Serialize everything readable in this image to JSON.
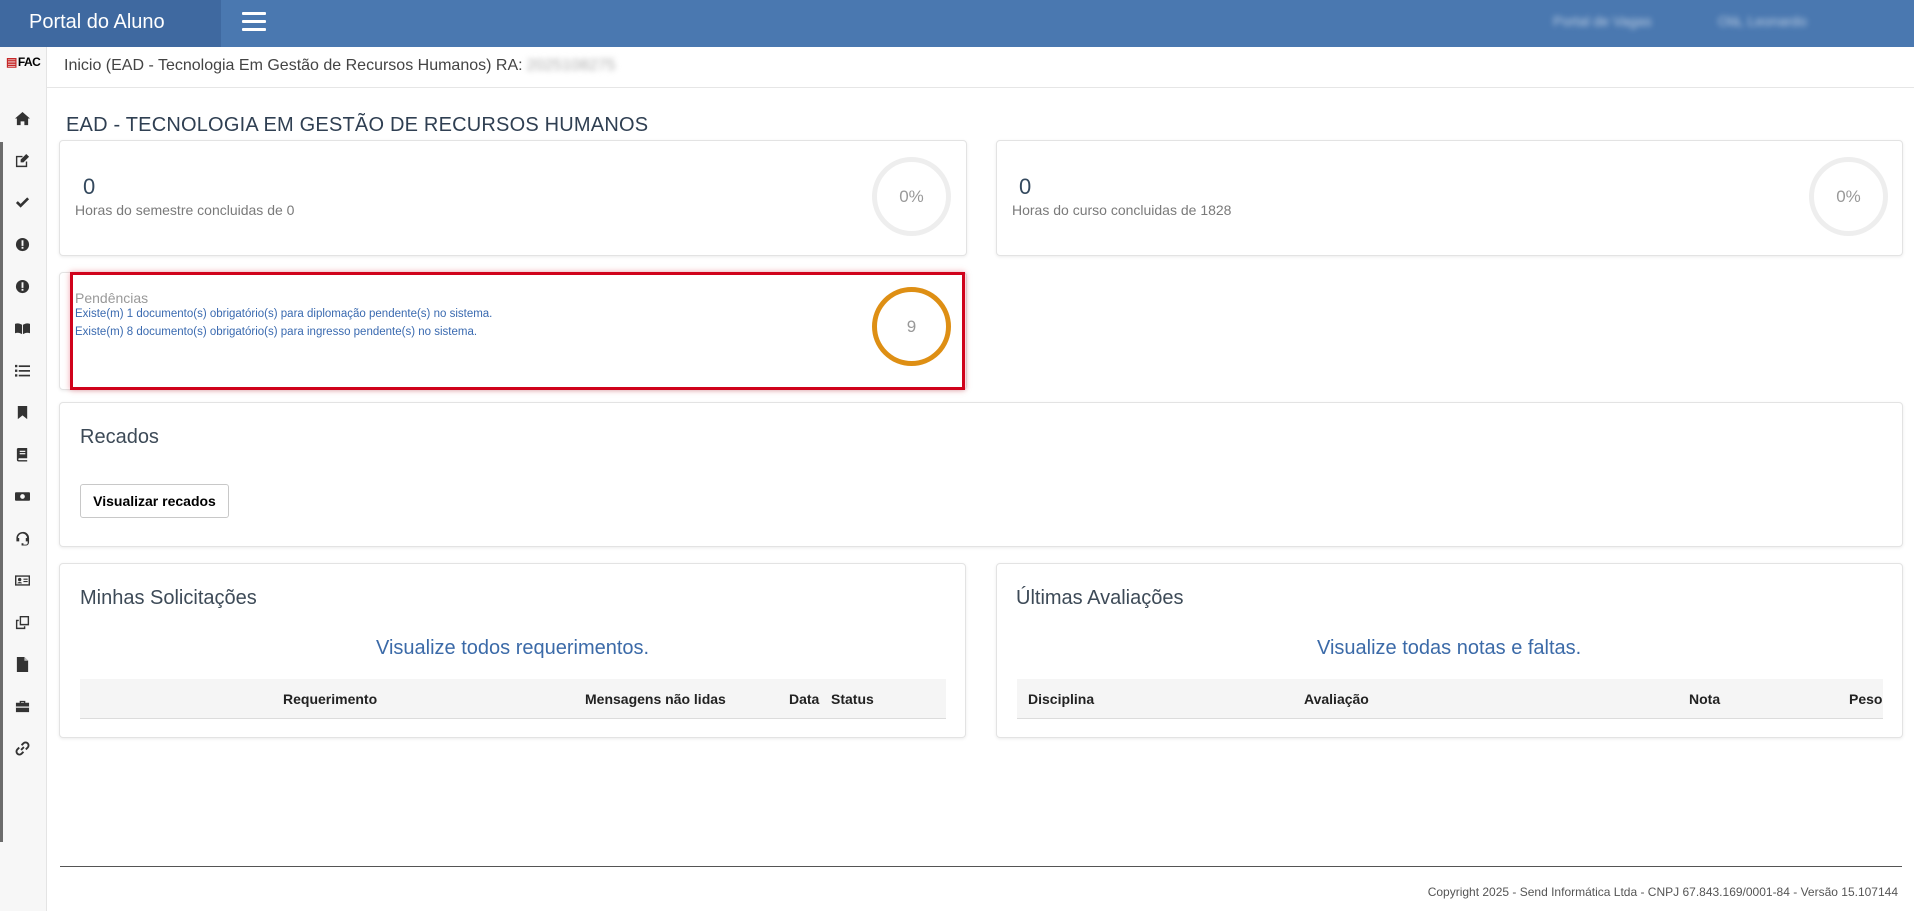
{
  "header": {
    "brand": "Portal do Aluno",
    "portal_vagas": "Portal de Vagas",
    "user": "Olá, Leonardo"
  },
  "sidebar": {
    "logo": "FAC",
    "icons": [
      "home-icon",
      "edit-icon",
      "check-icon",
      "alert-icon",
      "alert-icon-2",
      "book-open-icon",
      "list-icon",
      "bookmark-icon",
      "book-icon",
      "money-icon",
      "headset-icon",
      "id-card-icon",
      "clone-icon",
      "file-icon",
      "briefcase-icon",
      "link-icon"
    ]
  },
  "breadcrumb": {
    "text": "Inicio (EAD - Tecnologia Em Gestão de Recursos Humanos) RA:",
    "ra": "2025108275"
  },
  "page_title": "EAD - TECNOLOGIA EM GESTÃO DE RECURSOS HUMANOS",
  "semester": {
    "value": "0",
    "label": "Horas do semestre concluidas de 0",
    "percent": "0%"
  },
  "course": {
    "value": "0",
    "label": "Horas do curso concluidas de 1828",
    "percent": "0%"
  },
  "pendencias": {
    "title": "Pendências",
    "items": [
      "Existe(m) 1 documento(s) obrigatório(s) para diplomação pendente(s) no sistema.",
      "Existe(m) 8 documento(s) obrigatório(s) para ingresso pendente(s) no sistema."
    ],
    "count": "9",
    "ring_color": "#de8f14"
  },
  "recados": {
    "title": "Recados",
    "button": "Visualizar recados"
  },
  "solicitacoes": {
    "title": "Minhas Solicitações",
    "view_all": "Visualize todos requerimentos.",
    "columns": [
      "Requerimento",
      "Mensagens não lidas",
      "Data",
      "Status"
    ]
  },
  "avaliacoes": {
    "title": "Últimas Avaliações",
    "view_all": "Visualize todas notas e faltas.",
    "columns": [
      "Disciplina",
      "Avaliação",
      "Nota",
      "Peso"
    ]
  },
  "footer": "Copyright 2025 - Send Informática Ltda - CNPJ 67.843.169/0001-84 - Versão 15.107144",
  "colors": {
    "topbar": "#4a78b0",
    "brand_bg": "#3f69a0",
    "highlight": "#d0021b",
    "link": "#3b6aa8"
  }
}
